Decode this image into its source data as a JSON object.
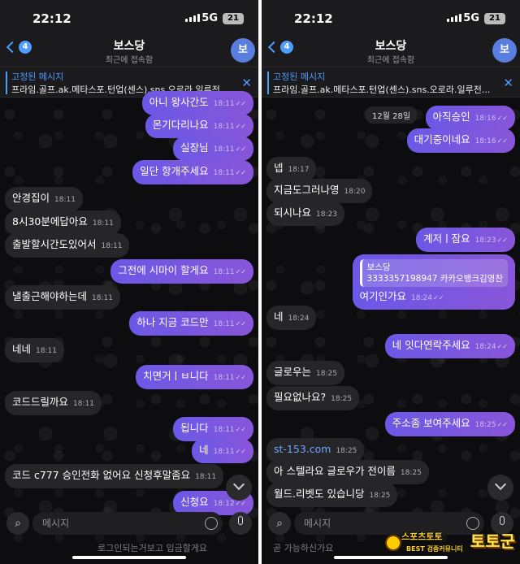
{
  "status": {
    "time": "22:12",
    "network": "5G",
    "battery": "21"
  },
  "header": {
    "back_count": "4",
    "name": "보스당",
    "subtitle": "최근에 접속함",
    "avatar_letter": "보"
  },
  "pinned": {
    "title": "고정된 메시지",
    "text": "프라임.골프.ak.메타스포.턴업(센스).sns.오로라.일루전..."
  },
  "input": {
    "placeholder": "메시지"
  },
  "colors": {
    "accent": "#4d9cff",
    "outgoing": "#7456e0",
    "incoming": "#262628"
  },
  "left": {
    "messages": [
      {
        "dir": "out",
        "text": "아니 왕사간도",
        "time": "18:11"
      },
      {
        "dir": "out",
        "text": "몬기다리나요",
        "time": "18:11"
      },
      {
        "dir": "out",
        "text": "실장님",
        "time": "18:11"
      },
      {
        "dir": "out",
        "text": "일단 항개주세요",
        "time": "18:11"
      },
      {
        "dir": "in",
        "text": "안경집이",
        "time": "18:11"
      },
      {
        "dir": "in",
        "text": "8시30분에답아요",
        "time": "18:11"
      },
      {
        "dir": "in",
        "text": "출발할시간도있어서",
        "time": "18:11"
      },
      {
        "dir": "out",
        "text": "그전에 시마이 할게요",
        "time": "18:11"
      },
      {
        "dir": "in",
        "text": "낼출근해야하는데",
        "time": "18:11"
      },
      {
        "dir": "out",
        "text": "하나 지금 코드만",
        "time": "18:11"
      },
      {
        "dir": "in",
        "text": "네네",
        "time": "18:11"
      },
      {
        "dir": "out",
        "text": "치면거ㅣㅂ니다",
        "time": "18:11"
      },
      {
        "dir": "in",
        "text": "코드드릴까요",
        "time": "18:11"
      },
      {
        "dir": "out",
        "text": "됩니다",
        "time": "18:11"
      },
      {
        "dir": "out",
        "text": "네",
        "time": "18:11"
      },
      {
        "dir": "in",
        "text": "코드 c777 승인전화 없어요 신청후말좀요",
        "time": "18:11"
      },
      {
        "dir": "out",
        "text": "신청요",
        "time": "18:12"
      }
    ],
    "peek": "로그인되는거보고 입금할게요"
  },
  "right": {
    "date": "12월 28일",
    "messages": [
      {
        "dir": "out",
        "text": "아직승인",
        "time": "18:16"
      },
      {
        "dir": "out",
        "text": "대기중이네요",
        "time": "18:16"
      },
      {
        "dir": "in",
        "text": "넵",
        "time": "18:17"
      },
      {
        "dir": "in",
        "text": "지금도그러나영",
        "time": "18:20"
      },
      {
        "dir": "in",
        "text": "되시나요",
        "time": "18:23"
      },
      {
        "dir": "out",
        "text": "계저ㅣ잠요",
        "time": "18:23"
      },
      {
        "dir": "out",
        "reply_name": "보스당",
        "reply_text": "3333357198947 카카오뱅크김영찬",
        "text": "여기인가요",
        "time": "18:24"
      },
      {
        "dir": "in",
        "text": "네",
        "time": "18:24"
      },
      {
        "dir": "out",
        "text": "네 잇다연락주세요",
        "time": "18:24"
      },
      {
        "dir": "in",
        "text": "글로우는",
        "time": "18:25"
      },
      {
        "dir": "in",
        "text": "필요없나요?",
        "time": "18:25"
      },
      {
        "dir": "out",
        "text": "주소좀 보여주세요",
        "time": "18:25"
      },
      {
        "dir": "in",
        "text": "st-153.com",
        "time": "18:25"
      },
      {
        "dir": "in",
        "text": "아 스텔라요 글로우가 전이름",
        "time": "18:25"
      },
      {
        "dir": "in",
        "text": "월드.리벳도 있습니당",
        "time": "18:25"
      }
    ],
    "peek": "곧 가능하신가요"
  },
  "watermark": {
    "line1": "스포츠토토",
    "line2": "BEST 검증커뮤니티",
    "brand": "토토군"
  }
}
